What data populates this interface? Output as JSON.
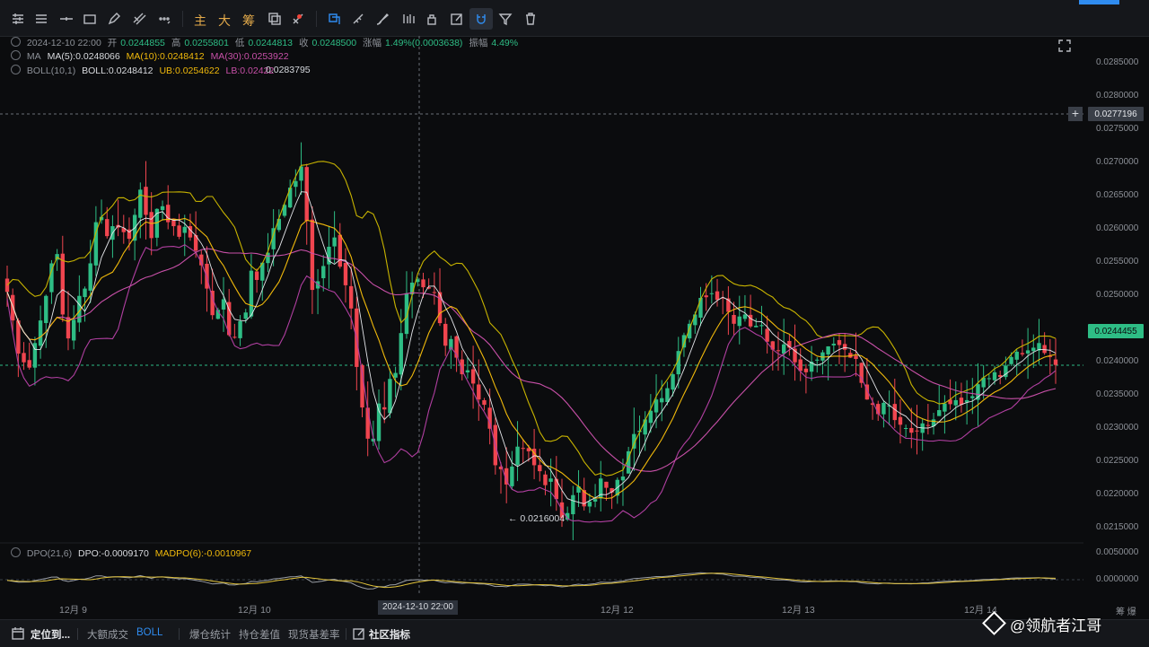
{
  "toolbar": {
    "quick_labels": [
      "主",
      "大",
      "筹"
    ],
    "accent": "#2f8cf0"
  },
  "ohlc": {
    "datetime": "2024-12-10 22:00",
    "open_label": "开",
    "open": "0.0244855",
    "high_label": "高",
    "high": "0.0255801",
    "low_label": "低",
    "low": "0.0244813",
    "close_label": "收",
    "close": "0.0248500",
    "change_label": "涨幅",
    "change": "1.49%(0.0003638)",
    "amp_label": "振幅",
    "amp": "4.49%"
  },
  "ma": {
    "name": "MA",
    "ma5": "MA(5):0.0248066",
    "ma10": "MA(10):0.0248412",
    "ma30": "MA(30):0.0253922"
  },
  "boll": {
    "name": "BOLL(10,1)",
    "mid": "BOLL:0.0248412",
    "ub": "UB:0.0254622",
    "lb": "LB:0.02422"
  },
  "annotations": {
    "high_mark": "0.0283795",
    "low_mark": "0.0216004"
  },
  "price_axis": {
    "labels": [
      "0.0285000",
      "0.0280000",
      "0.0275000",
      "0.0270000",
      "0.0265000",
      "0.0260000",
      "0.0255000",
      "0.0250000",
      "0.0245000",
      "0.0240000",
      "0.0235000",
      "0.0230000",
      "0.0225000",
      "0.0220000",
      "0.0215000"
    ],
    "crosshair_price": "0.0277196",
    "last_price": "0.0244455"
  },
  "dpo": {
    "name": "DPO(21,6)",
    "dpo": "DPO:-0.0009170",
    "madpo": "MADPO(6):-0.0010967",
    "labels": [
      "0.0050000",
      "0.0000000"
    ]
  },
  "time_axis": {
    "labels": [
      "12月 9",
      "12月 10",
      "12月 12",
      "12月 13",
      "12月 14"
    ],
    "crosshair_time": "2024-12-10 22:00",
    "right_extra": "筹 爆"
  },
  "bottom_bar": {
    "locate": "定位到...",
    "big_trade": "大额成交",
    "boll": "BOLL",
    "liq_stats": "爆仓统计",
    "oi_diff": "持仓差值",
    "basis": "现货基差率",
    "community": "社区指标"
  },
  "watermark": "@领航者江哥",
  "colors": {
    "up": "#2ebd85",
    "down": "#f0454f",
    "ma5": "#e4e6ea",
    "ma10": "#f0b90b",
    "ma30": "#c850a8",
    "ub": "#c8b400",
    "lb": "#b03fa0",
    "dpo": "#9a9ea5",
    "madpo": "#e1c23a"
  },
  "chart_data": {
    "type": "candlestick",
    "price_range": [
      0.02135,
      0.02885
    ],
    "closes": [
      0.02555,
      0.02512,
      0.02462,
      0.02449,
      0.02441,
      0.02478,
      0.02512,
      0.02549,
      0.02598,
      0.02612,
      0.02521,
      0.02485,
      0.02513,
      0.02549,
      0.0256,
      0.02598,
      0.0266,
      0.02668,
      0.02639,
      0.02654,
      0.02652,
      0.02645,
      0.02635,
      0.02671,
      0.02709,
      0.02671,
      0.02636,
      0.0268,
      0.02684,
      0.0266,
      0.02654,
      0.02638,
      0.02653,
      0.02637,
      0.02617,
      0.02595,
      0.0256,
      0.0252,
      0.02528,
      0.02544,
      0.0249,
      0.02487,
      0.02511,
      0.02524,
      0.02587,
      0.02573,
      0.02599,
      0.02614,
      0.02651,
      0.02665,
      0.02686,
      0.02712,
      0.02722,
      0.02744,
      0.02662,
      0.02558,
      0.02571,
      0.02594,
      0.02623,
      0.02637,
      0.02593,
      0.02565,
      0.0253,
      0.02442,
      0.02381,
      0.02334,
      0.02334,
      0.02387,
      0.02378,
      0.02424,
      0.02433,
      0.02493,
      0.02553,
      0.02569,
      0.02574,
      0.02562,
      0.0256,
      0.02554,
      0.02508,
      0.02474,
      0.02484,
      0.02456,
      0.02431,
      0.02437,
      0.02417,
      0.02393,
      0.02385,
      0.02349,
      0.02294,
      0.02288,
      0.02265,
      0.02292,
      0.02322,
      0.02319,
      0.02315,
      0.02294,
      0.02285,
      0.02264,
      0.02274,
      0.02243,
      0.02215,
      0.02222,
      0.02249,
      0.02262,
      0.02232,
      0.02239,
      0.02243,
      0.02274,
      0.0226,
      0.02253,
      0.02272,
      0.02277,
      0.02315,
      0.02341,
      0.02346,
      0.02363,
      0.02376,
      0.02393,
      0.02395,
      0.0241,
      0.02431,
      0.02466,
      0.0249,
      0.02507,
      0.02521,
      0.02546,
      0.02547,
      0.02553,
      0.02543,
      0.02546,
      0.02525,
      0.02507,
      0.02518,
      0.02521,
      0.02503,
      0.02504,
      0.02505,
      0.0248,
      0.02468,
      0.02467,
      0.02476,
      0.02471,
      0.02449,
      0.02436,
      0.02434,
      0.0245,
      0.02453,
      0.02464,
      0.02473,
      0.02477,
      0.02475,
      0.02468,
      0.02456,
      0.02454,
      0.02418,
      0.02393,
      0.02385,
      0.02371,
      0.02388,
      0.02384,
      0.02362,
      0.02355,
      0.0235,
      0.02343,
      0.02346,
      0.02357,
      0.02354,
      0.02363,
      0.02377,
      0.02387,
      0.02386,
      0.02392,
      0.02385,
      0.02392,
      0.02398,
      0.02416,
      0.02426,
      0.02425,
      0.02434,
      0.02427,
      0.02444,
      0.02457,
      0.02465,
      0.02461,
      0.02467,
      0.02471,
      0.02478,
      0.02463,
      0.02457,
      0.02445
    ]
  }
}
